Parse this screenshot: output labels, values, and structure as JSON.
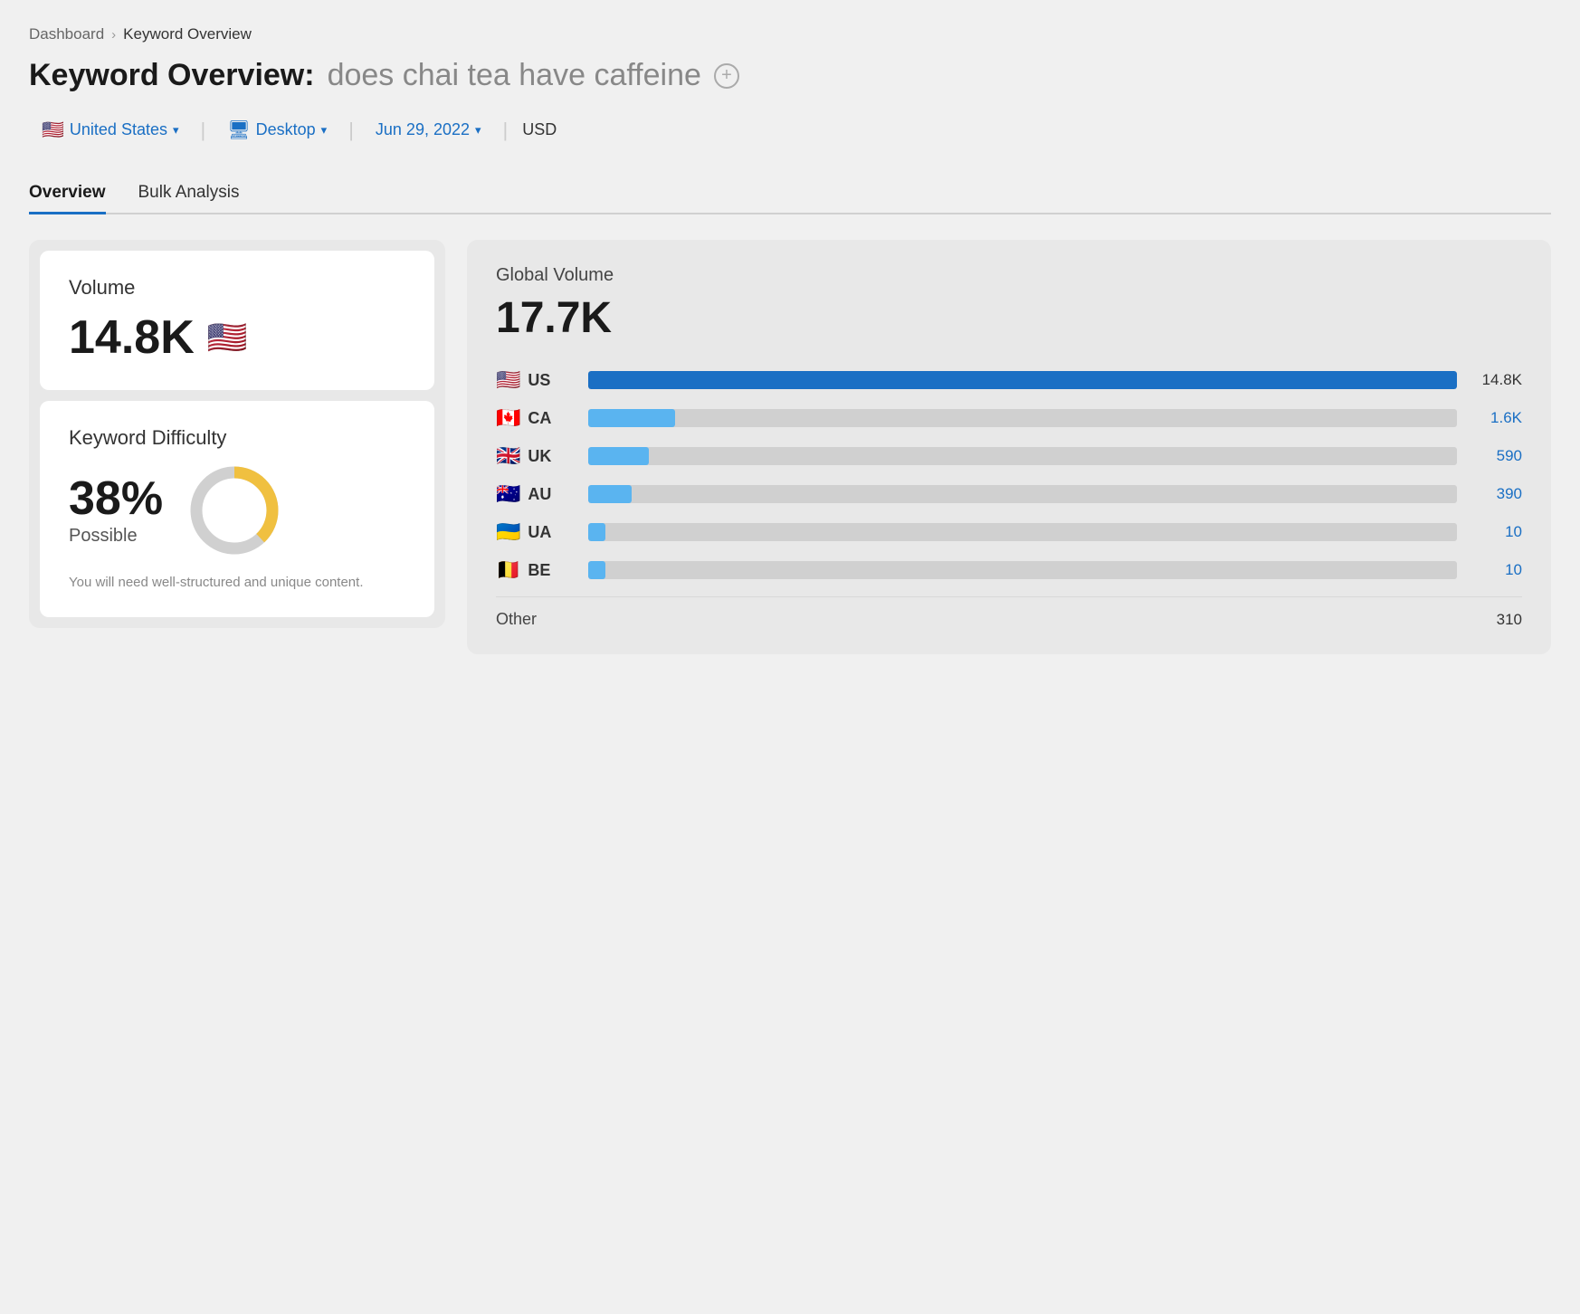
{
  "breadcrumb": {
    "home": "Dashboard",
    "separator": "›",
    "current": "Keyword Overview"
  },
  "pageTitle": {
    "prefix": "Keyword Overview:",
    "keyword": "does chai tea have caffeine",
    "addIconLabel": "+"
  },
  "filters": {
    "country": {
      "flag": "🇺🇸",
      "label": "United States",
      "chevron": "▾"
    },
    "device": {
      "icon": "🖥",
      "label": "Desktop",
      "chevron": "▾"
    },
    "date": {
      "label": "Jun 29, 2022",
      "chevron": "▾"
    },
    "currency": "USD"
  },
  "tabs": [
    {
      "id": "overview",
      "label": "Overview",
      "active": true
    },
    {
      "id": "bulk",
      "label": "Bulk Analysis",
      "active": false
    }
  ],
  "volumeCard": {
    "label": "Volume",
    "value": "14.8K",
    "flag": "🇺🇸"
  },
  "keywordDifficulty": {
    "label": "Keyword Difficulty",
    "percent": "38%",
    "status": "Possible",
    "note": "You will need well-structured and unique content.",
    "donut": {
      "percent": 38,
      "colorFilled": "#f0c040",
      "colorTrack": "#d0d0d0"
    }
  },
  "globalVolume": {
    "label": "Global Volume",
    "value": "17.7K"
  },
  "countries": [
    {
      "flag": "🇺🇸",
      "code": "US",
      "barPercent": 100,
      "barType": "dark-blue",
      "value": "14.8K",
      "valueBlue": false
    },
    {
      "flag": "🇨🇦",
      "code": "CA",
      "barPercent": 10,
      "barType": "light-blue",
      "value": "1.6K",
      "valueBlue": true
    },
    {
      "flag": "🇬🇧",
      "code": "UK",
      "barPercent": 7,
      "barType": "light-blue",
      "value": "590",
      "valueBlue": true
    },
    {
      "flag": "🇦🇺",
      "code": "AU",
      "barPercent": 5,
      "barType": "light-blue",
      "value": "390",
      "valueBlue": true
    },
    {
      "flag": "🇺🇦",
      "code": "UA",
      "barPercent": 2,
      "barType": "light-blue",
      "value": "10",
      "valueBlue": true
    },
    {
      "flag": "🇧🇪",
      "code": "BE",
      "barPercent": 2,
      "barType": "light-blue",
      "value": "10",
      "valueBlue": true
    }
  ],
  "other": {
    "label": "Other",
    "value": "310"
  }
}
